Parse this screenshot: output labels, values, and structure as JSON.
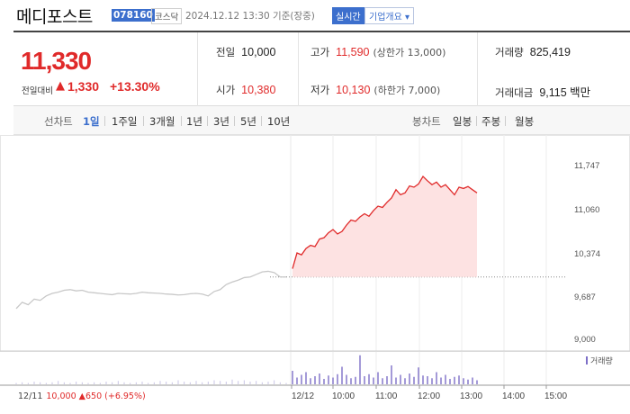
{
  "header": {
    "name": "메디포스트",
    "code": "078160",
    "market": "코스닥",
    "as_of": "2024.12.12 13:30 기준(장중)",
    "realtime_label": "실시간",
    "company_info_label": "기업개요 ▾"
  },
  "summary": {
    "price": "11,330",
    "change_label": "전일대비",
    "change_arrow": "▲",
    "change": "1,330",
    "change_pct": "+13.30%",
    "prev_close_label": "전일",
    "prev_close": "10,000",
    "open_label": "시가",
    "open": "10,380",
    "high_label": "고가",
    "high": "11,590",
    "upper_limit": "(상한가 13,000)",
    "low_label": "저가",
    "low": "10,130",
    "lower_limit": "(하한가 7,000)",
    "volume_label": "거래량",
    "volume": "825,419",
    "trade_value_label": "거래대금",
    "trade_value": "9,115 백만"
  },
  "period_bar": {
    "line_chart_label": "선차트",
    "periods": [
      "1일",
      "1주일",
      "3개월",
      "1년",
      "3년",
      "5년",
      "10년"
    ],
    "active_period": "1일",
    "candle_chart_label": "봉차트",
    "candles": [
      "일봉",
      "주봉",
      "월봉"
    ]
  },
  "colors": {
    "up": "#e02a2a",
    "accent": "#3c6fcd",
    "prev_day_line": "#c8c8c8",
    "volume_bar": "#7d6fc7",
    "area_fill": "#fde2e2"
  },
  "chart_data": {
    "type": "line",
    "y_ticks": [
      "11,747",
      "11,060",
      "10,374",
      "9,687",
      "9,000"
    ],
    "ylim": [
      9000,
      11747
    ],
    "x_ticks": [
      "12/11",
      "12/12",
      "10:00",
      "11:00",
      "12:00",
      "13:00",
      "14:00",
      "15:00"
    ],
    "prev_day_info": {
      "date": "12/11",
      "close": "10,000",
      "arrow": "▲",
      "change": "650",
      "pct": "(+6.95%)"
    },
    "reference_price": 10000,
    "volume_legend": "거래량",
    "series": [
      {
        "session": "12/11",
        "values": [
          9500,
          9600,
          9560,
          9650,
          9630,
          9700,
          9740,
          9760,
          9790,
          9800,
          9780,
          9790,
          9760,
          9750,
          9740,
          9730,
          9720,
          9740,
          9735,
          9730,
          9740,
          9760,
          9750,
          9745,
          9740,
          9730,
          9725,
          9715,
          9720,
          9735,
          9740,
          9730,
          9700,
          9770,
          9800,
          9880,
          9920,
          9950,
          9990,
          10000,
          10040,
          10080,
          10090,
          10070,
          10000,
          10000
        ]
      },
      {
        "session": "12/12",
        "values": [
          10130,
          10380,
          10350,
          10450,
          10500,
          10480,
          10600,
          10620,
          10700,
          10750,
          10680,
          10720,
          10820,
          10900,
          10880,
          10950,
          11000,
          10960,
          11050,
          11120,
          11100,
          11180,
          11250,
          11380,
          11300,
          11330,
          11440,
          11420,
          11470,
          11590,
          11520,
          11460,
          11500,
          11420,
          11460,
          11380,
          11300,
          11420,
          11400,
          11430,
          11380,
          11330
        ]
      }
    ],
    "volume": {
      "12/11": [
        2,
        3,
        2,
        4,
        3,
        2,
        3,
        5,
        3,
        2,
        4,
        3,
        2,
        3,
        2,
        4,
        3,
        5,
        3,
        2,
        3,
        4,
        2,
        3,
        5,
        4,
        3,
        6,
        4,
        3,
        5,
        3,
        4,
        6,
        5,
        4,
        7,
        5,
        6,
        4,
        5,
        3,
        4,
        6,
        3,
        2
      ],
      "12/12": [
        20,
        10,
        14,
        18,
        9,
        12,
        16,
        8,
        13,
        10,
        15,
        26,
        14,
        9,
        11,
        43,
        12,
        15,
        10,
        18,
        9,
        12,
        28,
        10,
        14,
        9,
        16,
        11,
        25,
        13,
        12,
        9,
        18,
        10,
        14,
        8,
        11,
        13,
        9,
        7,
        10,
        6
      ]
    }
  }
}
